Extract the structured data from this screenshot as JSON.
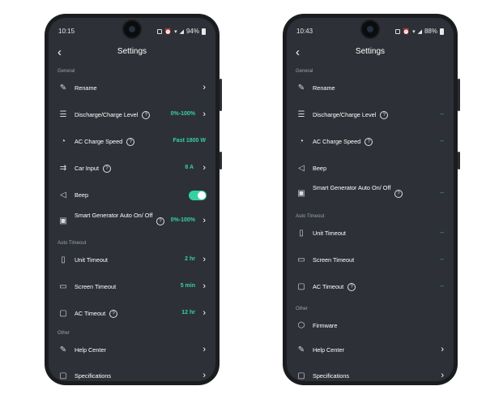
{
  "header": {
    "back_icon": "back-arrow-icon",
    "title": "Settings"
  },
  "colors": {
    "accent": "#36d1a0",
    "background": "#2d3137",
    "text": "#ffffff"
  },
  "left_phone": {
    "status": {
      "time": "10:15",
      "battery": "94%"
    },
    "sections": {
      "general": "General",
      "auto_timeout": "Auto Timeout",
      "other": "Other"
    },
    "rows": {
      "rename": "Rename",
      "discharge": {
        "label": "Discharge/Charge Level",
        "value": "0%-100%"
      },
      "ac_speed": {
        "label": "AC Charge Speed",
        "value": "Fast 1800 W"
      },
      "car_input": {
        "label": "Car Input",
        "value": "8 A"
      },
      "beep": {
        "label": "Beep",
        "toggle_on": true
      },
      "smart_gen": {
        "label": "Smart Generator Auto On/ Off",
        "value": "0%-100%"
      },
      "unit_timeout": {
        "label": "Unit Timeout",
        "value": "2 hr"
      },
      "screen_timeout": {
        "label": "Screen Timeout",
        "value": "5 min"
      },
      "ac_timeout": {
        "label": "AC Timeout",
        "value": "12 hr"
      },
      "help_center": "Help Center",
      "specifications": "Specifications"
    }
  },
  "right_phone": {
    "status": {
      "time": "10:43",
      "battery": "88%"
    },
    "sections": {
      "general": "General",
      "auto_timeout": "Auto Timeout",
      "other": "Other"
    },
    "rows": {
      "rename": "Rename",
      "discharge": {
        "label": "Discharge/Charge Level",
        "value": "--"
      },
      "ac_speed": {
        "label": "AC Charge Speed",
        "value": "--"
      },
      "beep": "Beep",
      "smart_gen": {
        "label": "Smart Generator Auto On/ Off",
        "value": "--"
      },
      "unit_timeout": {
        "label": "Unit Timeout",
        "value": "--"
      },
      "screen_timeout": {
        "label": "Screen Timeout",
        "value": "--"
      },
      "ac_timeout": {
        "label": "AC Timeout",
        "value": "--"
      },
      "firmware": "Firmware",
      "help_center": "Help Center",
      "specifications": "Specifications"
    }
  }
}
